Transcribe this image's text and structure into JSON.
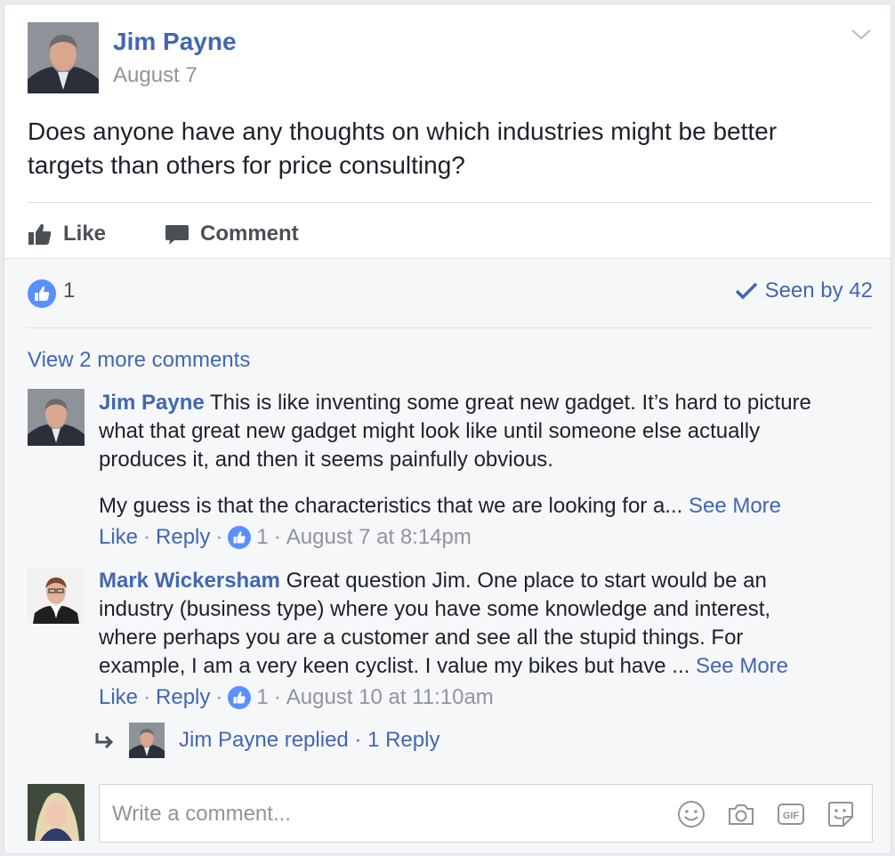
{
  "post": {
    "author": "Jim Payne",
    "date": "August 7",
    "text": "Does anyone have any thoughts on which industries might be better targets than others for price consulting?",
    "actions": {
      "like_label": "Like",
      "comment_label": "Comment"
    }
  },
  "summary": {
    "reaction_count": "1",
    "seen_by": "Seen by 42"
  },
  "view_more_comments": "View 2 more comments",
  "comments": [
    {
      "author": "Jim Payne",
      "text": "This is like inventing some great new gadget. It’s hard to picture what that great new gadget might look like until someone else actually produces it, and then it seems painfully obvious.",
      "text2": "My guess is that the characteristics that we are looking for a...",
      "see_more": "See More",
      "like_label": "Like",
      "reply_label": "Reply",
      "reactions": "1",
      "timestamp": "August 7 at 8:14pm"
    },
    {
      "author": "Mark Wickersham",
      "text": "Great question Jim. One place to start would be an industry (business type) where you have some knowledge and interest, where perhaps you are a customer and see all the stupid things. For example, I am a very keen cyclist. I value my bikes but have ...",
      "see_more": "See More",
      "like_label": "Like",
      "reply_label": "Reply",
      "reactions": "1",
      "timestamp": "August 10 at 11:10am",
      "reply_summary": "Jim Payne replied · 1 Reply"
    }
  ],
  "composer": {
    "placeholder": "Write a comment..."
  },
  "icons": {
    "menu": "chevron-down-icon",
    "like": "thumbs-up-icon",
    "comment": "speech-bubble-icon",
    "seen": "checkmark-icon",
    "reply_arrow": "reply-arrow-icon",
    "emoji": "smiley-icon",
    "camera": "camera-icon",
    "gif": "gif-icon",
    "sticker": "sticker-icon"
  },
  "colors": {
    "link": "#4267b2",
    "like_badge": "#5890ff",
    "meta": "#90949c",
    "text": "#1d2129"
  }
}
